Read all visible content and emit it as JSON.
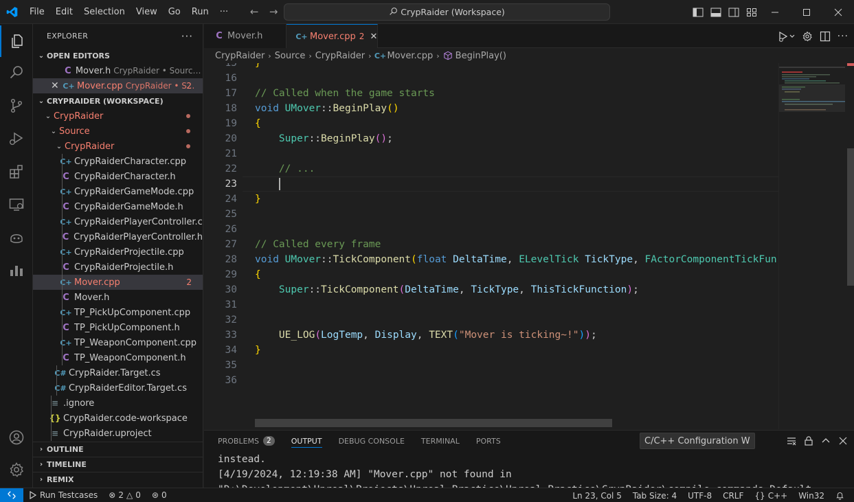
{
  "titlebar": {
    "menus": [
      "File",
      "Edit",
      "Selection",
      "View",
      "Go",
      "Run",
      "···"
    ],
    "search_text": "CrypRaider (Workspace)"
  },
  "sidebar": {
    "title": "EXPLORER",
    "open_editors": {
      "label": "OPEN EDITORS",
      "items": [
        {
          "name": "Mover.h",
          "desc": "CrypRaider • Source\\Cr..."
        },
        {
          "name": "Mover.cpp",
          "desc": "CrypRaider • S...",
          "badge": "2"
        }
      ]
    },
    "workspace": {
      "label": "CRYPRAIDER (WORKSPACE)",
      "root": "CrypRaider",
      "source": "Source",
      "module": "CrypRaider",
      "files": [
        {
          "name": "CrypRaiderCharacter.cpp",
          "type": "cpp"
        },
        {
          "name": "CrypRaiderCharacter.h",
          "type": "h"
        },
        {
          "name": "CrypRaiderGameMode.cpp",
          "type": "cpp"
        },
        {
          "name": "CrypRaiderGameMode.h",
          "type": "h"
        },
        {
          "name": "CrypRaiderPlayerController.cpp",
          "type": "cpp"
        },
        {
          "name": "CrypRaiderPlayerController.h",
          "type": "h"
        },
        {
          "name": "CrypRaiderProjectile.cpp",
          "type": "cpp"
        },
        {
          "name": "CrypRaiderProjectile.h",
          "type": "h"
        },
        {
          "name": "Mover.cpp",
          "type": "cpp",
          "badge": "2"
        },
        {
          "name": "Mover.h",
          "type": "h"
        },
        {
          "name": "TP_PickUpComponent.cpp",
          "type": "cpp"
        },
        {
          "name": "TP_PickUpComponent.h",
          "type": "h"
        },
        {
          "name": "TP_WeaponComponent.cpp",
          "type": "cpp"
        },
        {
          "name": "TP_WeaponComponent.h",
          "type": "h"
        }
      ],
      "source_files": [
        {
          "name": "CrypRaider.Target.cs",
          "type": "cs"
        },
        {
          "name": "CrypRaiderEditor.Target.cs",
          "type": "cs"
        }
      ],
      "root_files": [
        {
          "name": ".ignore",
          "type": "lines"
        },
        {
          "name": "CrypRaider.code-workspace",
          "type": "json"
        },
        {
          "name": "CrypRaider.uproject",
          "type": "lines"
        }
      ]
    },
    "outline": "OUTLINE",
    "timeline": "TIMELINE",
    "remix": "REMIX"
  },
  "editor": {
    "tabs": [
      {
        "label": "Mover.h",
        "active": false
      },
      {
        "label": "Mover.cpp",
        "active": true,
        "badge": "2"
      }
    ],
    "breadcrumb": [
      "CrypRaider",
      "Source",
      "CrypRaider",
      "Mover.cpp",
      "BeginPlay()"
    ],
    "current_line": "23",
    "lines": [
      {
        "n": "15",
        "html": "<span class=\"tk-br1\">}</span>"
      },
      {
        "n": "16",
        "html": ""
      },
      {
        "n": "17",
        "html": "<span class=\"tk-cm\">// Called when the game starts</span>"
      },
      {
        "n": "18",
        "html": "<span class=\"tk-kw\">void</span> <span class=\"tk-ty\">UMover</span><span class=\"tk-pl\">::</span><span class=\"tk-fn\">BeginPlay</span><span class=\"tk-br1\">()</span>"
      },
      {
        "n": "19",
        "html": "<span class=\"tk-br1\">{</span>"
      },
      {
        "n": "20",
        "html": "    <span class=\"tk-ty\">Super</span><span class=\"tk-pl\">::</span><span class=\"tk-fn\">BeginPlay</span><span class=\"tk-br2\">()</span><span class=\"tk-pl\">;</span>"
      },
      {
        "n": "21",
        "html": ""
      },
      {
        "n": "22",
        "html": "    <span class=\"tk-cm\">// ...</span>"
      },
      {
        "n": "23",
        "html": ""
      },
      {
        "n": "24",
        "html": "<span class=\"tk-br1\">}</span>"
      },
      {
        "n": "25",
        "html": ""
      },
      {
        "n": "26",
        "html": ""
      },
      {
        "n": "27",
        "html": "<span class=\"tk-cm\">// Called every frame</span>"
      },
      {
        "n": "28",
        "html": "<span class=\"tk-kw\">void</span> <span class=\"tk-ty\">UMover</span><span class=\"tk-pl\">::</span><span class=\"tk-fn\">TickComponent</span><span class=\"tk-br1\">(</span><span class=\"tk-kw\">float</span> <span class=\"tk-var\">DeltaTime</span><span class=\"tk-pl\">,</span> <span class=\"tk-ty\">ELevelTick</span> <span class=\"tk-var\">TickType</span><span class=\"tk-pl\">,</span> <span class=\"tk-ty\">FActorComponentTickFun</span>"
      },
      {
        "n": "29",
        "html": "<span class=\"tk-br1\">{</span>"
      },
      {
        "n": "30",
        "html": "    <span class=\"tk-ty\">Super</span><span class=\"tk-pl\">::</span><span class=\"tk-fn\">TickComponent</span><span class=\"tk-br2\">(</span><span class=\"tk-var\">DeltaTime</span><span class=\"tk-pl\">,</span> <span class=\"tk-var\">TickType</span><span class=\"tk-pl\">,</span> <span class=\"tk-var\">ThisTickFunction</span><span class=\"tk-br2\">)</span><span class=\"tk-pl\">;</span>"
      },
      {
        "n": "31",
        "html": ""
      },
      {
        "n": "32",
        "html": ""
      },
      {
        "n": "33",
        "html": "    <span class=\"tk-fn\">UE_LOG</span><span class=\"tk-br2\">(</span><span class=\"tk-var\">LogTemp</span><span class=\"tk-pl\">,</span> <span class=\"tk-var\">Display</span><span class=\"tk-pl\">,</span> <span class=\"tk-fn\">TEXT</span><span class=\"tk-br3\">(</span><span class=\"tk-str\">\"Mover is ticking~!\"</span><span class=\"tk-br3\">)</span><span class=\"tk-br2\">)</span><span class=\"tk-pl\">;</span>"
      },
      {
        "n": "34",
        "html": "<span class=\"tk-br1\">}</span>"
      },
      {
        "n": "35",
        "html": ""
      },
      {
        "n": "36",
        "html": ""
      }
    ]
  },
  "panel": {
    "tabs": [
      {
        "label": "PROBLEMS",
        "badge": "2"
      },
      {
        "label": "OUTPUT",
        "active": true
      },
      {
        "label": "DEBUG CONSOLE"
      },
      {
        "label": "TERMINAL"
      },
      {
        "label": "PORTS"
      }
    ],
    "output_channel": "C/C++ Configuration W",
    "output_lines": [
      "instead.",
      "[4/19/2024, 12:19:38 AM] \"Mover.cpp\" not found in",
      "\"D:\\Development\\Unreal\\Projects\\Unreal Practice\\Unreal Practice\\CrypRaider\\compile_commands.Default."
    ]
  },
  "statusbar": {
    "run_testcases": "Run Testcases",
    "errors": "2",
    "warnings": "0",
    "ports": "0",
    "position": "Ln 23, Col 5",
    "tab_size": "Tab Size: 4",
    "encoding": "UTF-8",
    "eol": "CRLF",
    "language": "C++",
    "platform": "Win32"
  },
  "colors": {
    "accent": "#0078d4",
    "error": "#f88070"
  }
}
